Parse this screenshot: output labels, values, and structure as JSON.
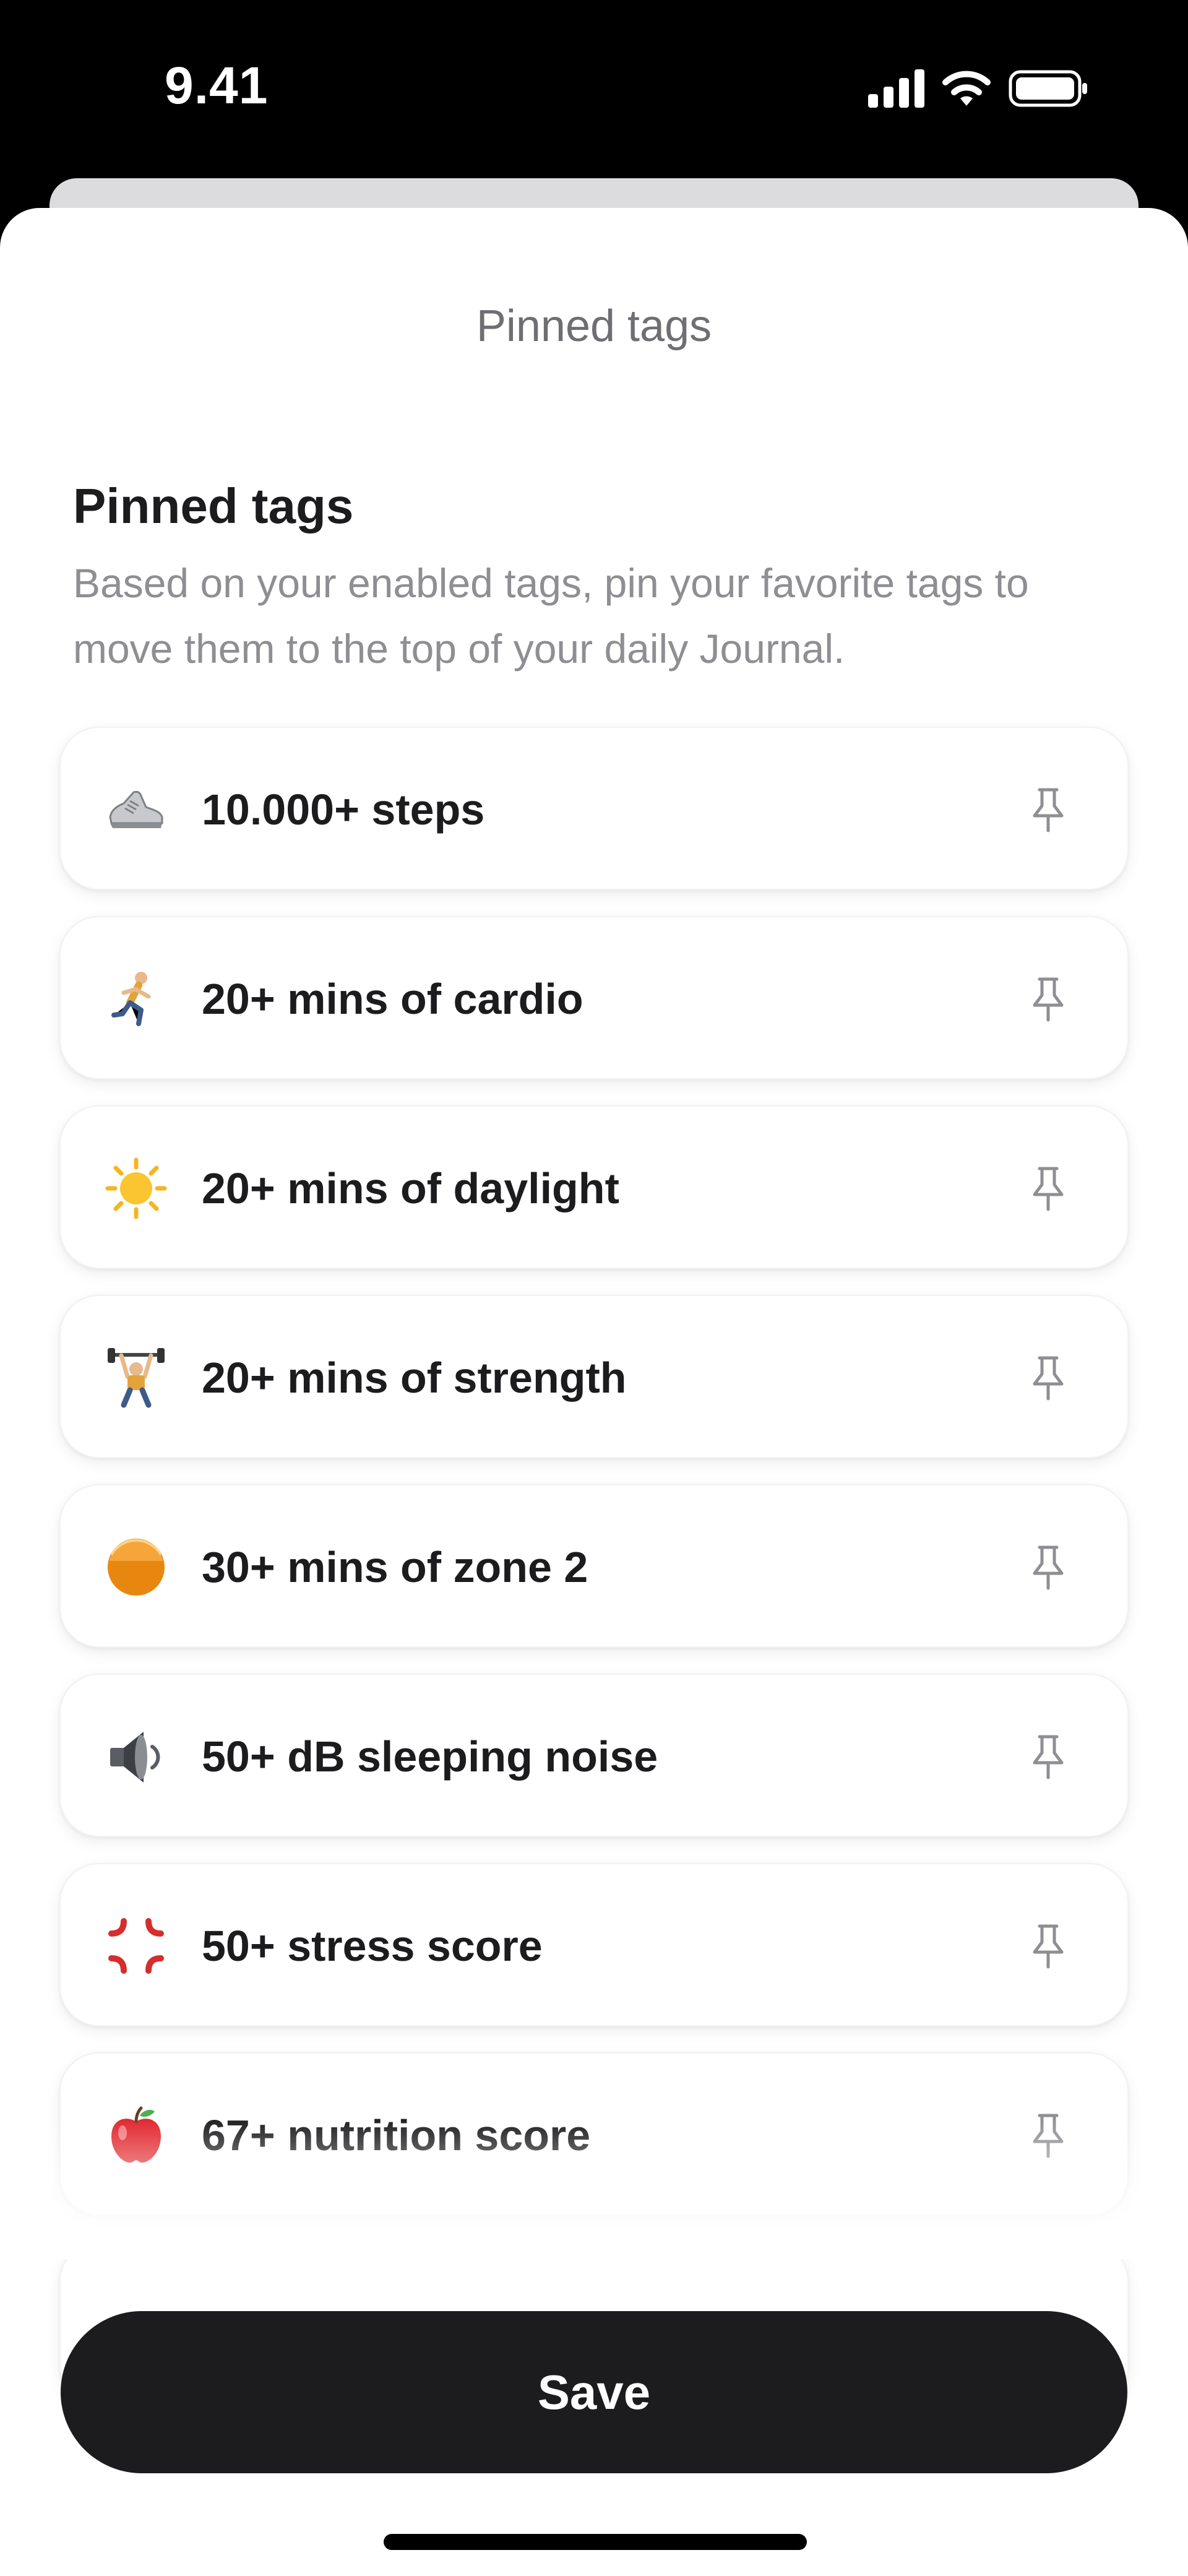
{
  "status_bar": {
    "time": "9.41"
  },
  "sheet": {
    "header_title": "Pinned tags",
    "section_title": "Pinned tags",
    "section_description": "Based on your enabled tags, pin your favorite tags to move them to the top of your daily Journal."
  },
  "tags": [
    {
      "label": "10.000+ steps",
      "icon": "sneaker-icon",
      "pinned": false
    },
    {
      "label": "20+ mins of cardio",
      "icon": "runner-icon",
      "pinned": false
    },
    {
      "label": "20+ mins of daylight",
      "icon": "sun-icon",
      "pinned": false
    },
    {
      "label": "20+ mins of strength",
      "icon": "weightlifter-icon",
      "pinned": false
    },
    {
      "label": "30+ mins of zone 2",
      "icon": "orange-circle-icon",
      "pinned": false
    },
    {
      "label": "50+ dB sleeping noise",
      "icon": "speaker-icon",
      "pinned": false
    },
    {
      "label": "50+ stress score",
      "icon": "anger-icon",
      "pinned": false
    },
    {
      "label": "67+ nutrition score",
      "icon": "apple-icon",
      "pinned": false
    }
  ],
  "save_label": "Save",
  "colors": {
    "accent_dark": "#1c1c1e",
    "secondary_text": "#8e8e93",
    "header_text": "#6e6e73"
  }
}
